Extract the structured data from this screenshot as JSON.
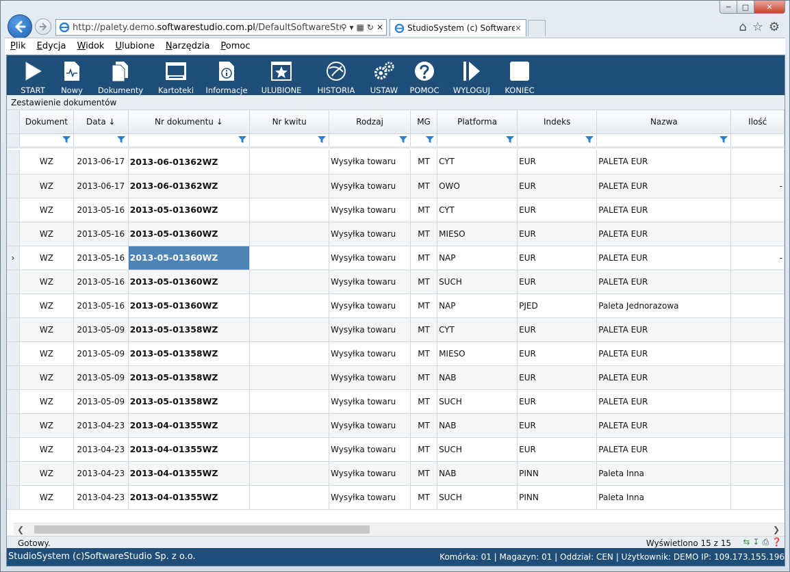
{
  "browser": {
    "url_prefix": "http://palety.demo.",
    "url_host": "softwarestudio.com.pl",
    "url_rest": "/DefaultSoftwareStudio.aspx?rol",
    "tab_title": "StudioSystem (c) SoftwareS...",
    "tab_close": "×"
  },
  "menu": [
    "Plik",
    "Edycja",
    "Widok",
    "Ulubione",
    "Narzędzia",
    "Pomoc"
  ],
  "toolbar": [
    {
      "label": "START",
      "icon": "play-icon"
    },
    {
      "label": "Nowy",
      "icon": "new-document-icon"
    },
    {
      "label": "Dokumenty",
      "icon": "documents-icon"
    },
    {
      "label": "Kartoteki",
      "icon": "window-icon"
    },
    {
      "label": "Informacje",
      "icon": "info-icon"
    },
    {
      "label": "ULUBIONE",
      "icon": "star-icon"
    },
    {
      "label": "HISTORIA",
      "icon": "history-icon"
    },
    {
      "label": "USTAW",
      "icon": "gears-icon"
    },
    {
      "label": "POMOC",
      "icon": "help-icon"
    },
    {
      "label": "WYLOGUJ",
      "icon": "logout-icon"
    },
    {
      "label": "KONIEC",
      "icon": "stop-icon"
    }
  ],
  "breadcrumb": "Zestawienie dokumentów",
  "grid": {
    "columns": [
      "Dokument",
      "Data ↓",
      "Nr dokumentu ↓",
      "Nr kwitu",
      "Rodzaj",
      "MG",
      "Platforma",
      "Indeks",
      "Nazwa",
      "Ilość"
    ],
    "rows": [
      [
        "WZ",
        "2013-06-17",
        "2013-06-01362WZ",
        "",
        "Wysyłka towaru",
        "MT",
        "CYT",
        "EUR",
        "PALETA EUR",
        ""
      ],
      [
        "WZ",
        "2013-06-17",
        "2013-06-01362WZ",
        "",
        "Wysyłka towaru",
        "MT",
        "OWO",
        "EUR",
        "PALETA EUR",
        "-"
      ],
      [
        "WZ",
        "2013-05-16",
        "2013-05-01360WZ",
        "",
        "Wysyłka towaru",
        "MT",
        "CYT",
        "EUR",
        "PALETA EUR",
        ""
      ],
      [
        "WZ",
        "2013-05-16",
        "2013-05-01360WZ",
        "",
        "Wysyłka towaru",
        "MT",
        "MIESO",
        "EUR",
        "PALETA EUR",
        ""
      ],
      [
        "WZ",
        "2013-05-16",
        "2013-05-01360WZ",
        "",
        "Wysyłka towaru",
        "MT",
        "NAP",
        "EUR",
        "PALETA EUR",
        "-"
      ],
      [
        "WZ",
        "2013-05-16",
        "2013-05-01360WZ",
        "",
        "Wysyłka towaru",
        "MT",
        "SUCH",
        "EUR",
        "PALETA EUR",
        ""
      ],
      [
        "WZ",
        "2013-05-16",
        "2013-05-01360WZ",
        "",
        "Wysyłka towaru",
        "MT",
        "NAP",
        "PJED",
        "Paleta Jednorazowa",
        ""
      ],
      [
        "WZ",
        "2013-05-09",
        "2013-05-01358WZ",
        "",
        "Wysyłka towaru",
        "MT",
        "CYT",
        "EUR",
        "PALETA EUR",
        ""
      ],
      [
        "WZ",
        "2013-05-09",
        "2013-05-01358WZ",
        "",
        "Wysyłka towaru",
        "MT",
        "MIESO",
        "EUR",
        "PALETA EUR",
        ""
      ],
      [
        "WZ",
        "2013-05-09",
        "2013-05-01358WZ",
        "",
        "Wysyłka towaru",
        "MT",
        "NAB",
        "EUR",
        "PALETA EUR",
        ""
      ],
      [
        "WZ",
        "2013-05-09",
        "2013-05-01358WZ",
        "",
        "Wysyłka towaru",
        "MT",
        "SUCH",
        "EUR",
        "PALETA EUR",
        ""
      ],
      [
        "WZ",
        "2013-04-23",
        "2013-04-01355WZ",
        "",
        "Wysyłka towaru",
        "MT",
        "NAB",
        "EUR",
        "PALETA EUR",
        ""
      ],
      [
        "WZ",
        "2013-04-23",
        "2013-04-01355WZ",
        "",
        "Wysyłka towaru",
        "MT",
        "SUCH",
        "EUR",
        "PALETA EUR",
        ""
      ],
      [
        "WZ",
        "2013-04-23",
        "2013-04-01355WZ",
        "",
        "Wysyłka towaru",
        "MT",
        "NAB",
        "PINN",
        "Paleta Inna",
        ""
      ],
      [
        "WZ",
        "2013-04-23",
        "2013-04-01355WZ",
        "",
        "Wysyłka towaru",
        "MT",
        "SUCH",
        "PINN",
        "Paleta Inna",
        ""
      ]
    ],
    "selected_row": 4,
    "row_indicator": "›"
  },
  "status": {
    "text": "Gotowy.",
    "shown": "Wyświetlono 15 z 15"
  },
  "footer": {
    "left": "StudioSystem (c)SoftwareStudio Sp. z o.o.",
    "right": "Komórka: 01 | Magazyn: 01 | Oddział: CEN | Użytkownik: DEMO IP: 109.173.155.196"
  },
  "colors": {
    "toolbar_bg": "#1f4e79",
    "selected_cell": "#4d84b7"
  }
}
